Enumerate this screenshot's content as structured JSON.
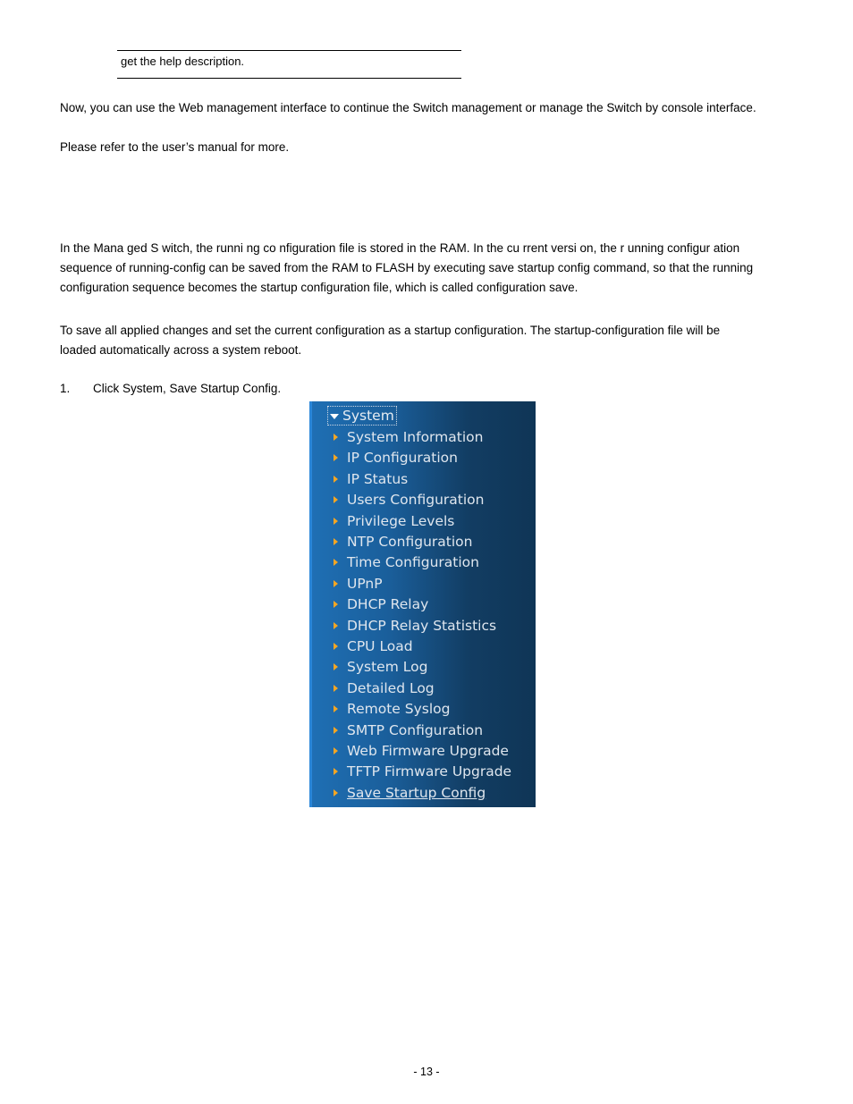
{
  "table_fragment": {
    "text": "get the help description."
  },
  "paragraphs": {
    "p1": "Now, you can use the Web management interface to continue the Switch management or manage the Switch by console interface.",
    "p2": "Please refer to the user’s manual for more.",
    "p3_lines": [
      "In the Mana  ged S witch, the  runni ng co nfiguration file is   stored in the    RAM. In the cu    rrent versi on, the r  unning configur ation",
      "sequence of running-config can be saved from the RAM to FLASH by executing save startup config command, so that the running",
      "configuration sequence becomes the startup configuration file, which is called configuration save."
    ],
    "p4_lines": [
      "To save all applied changes and set the current configuration as a startup configuration. The startup-configuration file will be",
      "loaded automatically across a system reboot."
    ],
    "step": {
      "number": "1.",
      "text": "Click System, Save Startup Config."
    }
  },
  "menu": {
    "header": "System",
    "items": [
      {
        "label": "System Information"
      },
      {
        "label": "IP Configuration"
      },
      {
        "label": "IP Status"
      },
      {
        "label": "Users Configuration"
      },
      {
        "label": "Privilege Levels"
      },
      {
        "label": "NTP Configuration"
      },
      {
        "label": "Time Configuration"
      },
      {
        "label": "UPnP"
      },
      {
        "label": "DHCP Relay"
      },
      {
        "label": "DHCP Relay Statistics"
      },
      {
        "label": "CPU Load"
      },
      {
        "label": "System Log"
      },
      {
        "label": "Detailed Log"
      },
      {
        "label": "Remote Syslog"
      },
      {
        "label": "SMTP Configuration"
      },
      {
        "label": "Web Firmware Upgrade"
      },
      {
        "label": "TFTP Firmware Upgrade"
      },
      {
        "label": "Save Startup Config",
        "active": true
      }
    ],
    "colors": {
      "bullet": "#f5a623",
      "text": "#dfe6ee",
      "bg_start": "#1f6fb4",
      "bg_end": "#0f3556"
    }
  },
  "footer": {
    "page_number": "- 13 -"
  }
}
